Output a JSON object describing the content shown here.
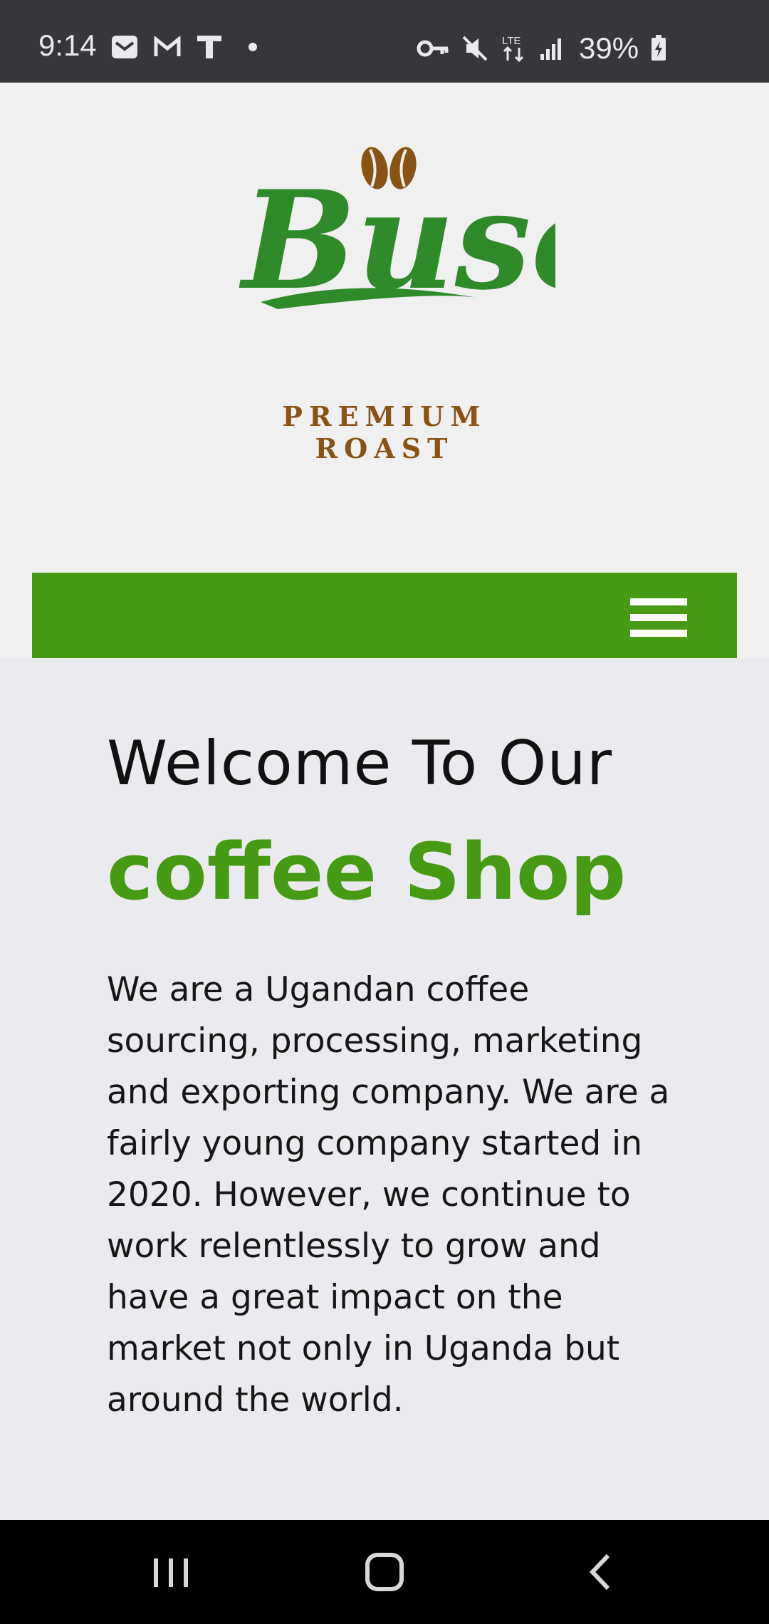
{
  "status_bar": {
    "time": "9:14",
    "battery_percent": "39%",
    "network": "LTE",
    "left_icons": [
      "mail-icon",
      "gmail-icon",
      "t-app-icon",
      "dot-icon"
    ],
    "right_icons": [
      "vpn-key-icon",
      "mute-icon",
      "lte-icon",
      "signal-icon",
      "battery-charging-icon"
    ]
  },
  "header": {
    "logo_text": "Buso",
    "logo_tagline": "PREMIUM ROAST",
    "brand_green": "#2f8a2a",
    "bean_brown": "#8a5316"
  },
  "nav": {
    "background_color": "#469a14",
    "menu_icon": "hamburger-menu-icon"
  },
  "main": {
    "heading_line1": "Welcome To Our",
    "heading_line2": "coffee Shop",
    "accent_color": "#469a14",
    "description": "We are a Ugandan coffee sourcing, processing, marketing and exporting company. We are a fairly young company started in 2020. However, we continue to work relentlessly to grow and have a great impact on the market not only in Uganda but around the world."
  },
  "android_nav": {
    "buttons": [
      "recents-icon",
      "home-icon",
      "back-icon"
    ]
  }
}
